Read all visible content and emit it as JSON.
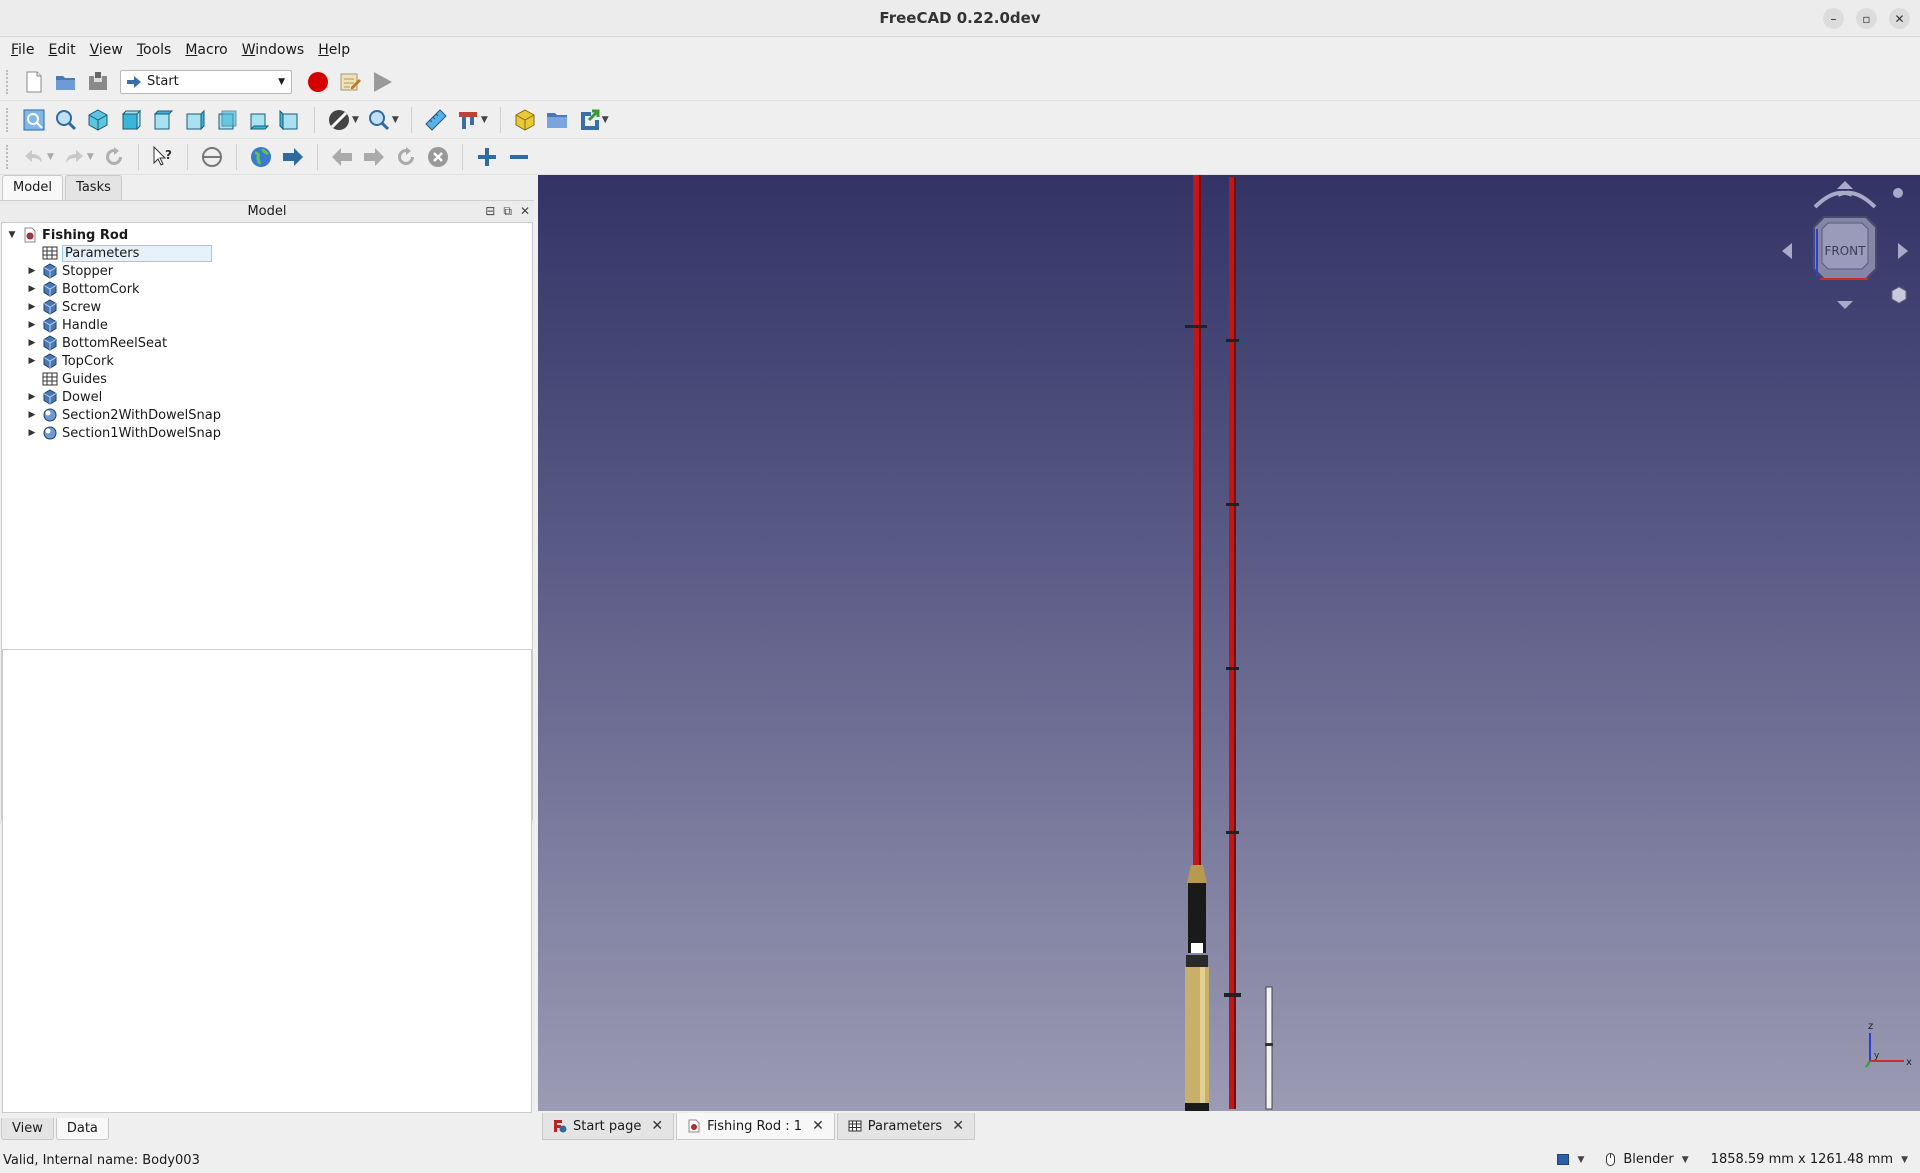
{
  "window": {
    "title": "FreeCAD 0.22.0dev",
    "minimize": "–",
    "restore": "▫",
    "close": "✕"
  },
  "menu": [
    {
      "label": "File",
      "mnemonic": "F",
      "rest": "ile"
    },
    {
      "label": "Edit",
      "mnemonic": "E",
      "rest": "dit"
    },
    {
      "label": "View",
      "mnemonic": "V",
      "rest": "iew"
    },
    {
      "label": "Tools",
      "mnemonic": "T",
      "rest": "ools"
    },
    {
      "label": "Macro",
      "mnemonic": "M",
      "rest": "acro"
    },
    {
      "label": "Windows",
      "mnemonic": "W",
      "rest": "indows"
    },
    {
      "label": "Help",
      "mnemonic": "H",
      "rest": "elp"
    }
  ],
  "workbench": {
    "selected": "Start"
  },
  "left_panel": {
    "tabs": [
      "Model",
      "Tasks"
    ],
    "header": "Model",
    "header_buttons": [
      "⊟",
      "⧉",
      "✕"
    ],
    "bottom_tabs": [
      "View",
      "Data"
    ]
  },
  "tree": {
    "root": "Fishing Rod",
    "items": [
      {
        "label": "Parameters",
        "icon": "spreadsheet-icon",
        "expandable": false,
        "selected": true
      },
      {
        "label": "Stopper",
        "icon": "body-icon",
        "expandable": true
      },
      {
        "label": "BottomCork",
        "icon": "body-icon",
        "expandable": true
      },
      {
        "label": "Screw",
        "icon": "body-icon",
        "expandable": true
      },
      {
        "label": "Handle",
        "icon": "body-icon",
        "expandable": true
      },
      {
        "label": "BottomReelSeat",
        "icon": "body-icon",
        "expandable": true
      },
      {
        "label": "TopCork",
        "icon": "body-icon",
        "expandable": true
      },
      {
        "label": "Guides",
        "icon": "spreadsheet-icon",
        "expandable": false
      },
      {
        "label": "Dowel",
        "icon": "body-icon",
        "expandable": true
      },
      {
        "label": "Section2WithDowelSnap",
        "icon": "part-icon",
        "expandable": true
      },
      {
        "label": "Section1WithDowelSnap",
        "icon": "part-icon",
        "expandable": true
      }
    ]
  },
  "navcube": {
    "face": "FRONT"
  },
  "axis": {
    "z": "z",
    "y": "y",
    "x": "x"
  },
  "doc_tabs": [
    {
      "label": "Start page",
      "icon": "freecad-icon",
      "active": false
    },
    {
      "label": "Fishing Rod : 1",
      "icon": "document-icon",
      "active": true
    },
    {
      "label": "Parameters",
      "icon": "spreadsheet-icon",
      "active": false
    }
  ],
  "status": {
    "message": "Valid, Internal name: Body003",
    "navigation_style": "Blender",
    "dimensions": "1858.59 mm x 1261.48 mm"
  },
  "colors": {
    "rod_red": "#c01818",
    "cork_tan": "#c8b06a",
    "view_top": "#333366",
    "view_bottom": "#9b9bb4"
  }
}
